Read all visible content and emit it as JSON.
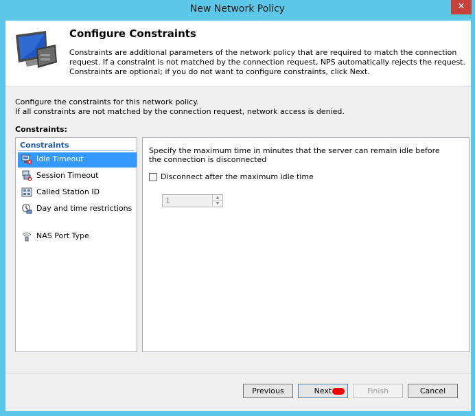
{
  "window": {
    "title": "New Network Policy",
    "close_symbol": "✕"
  },
  "header": {
    "title": "Configure Constraints",
    "description": "Constraints are additional parameters of the network policy that are required to match the connection request. If a constraint is not matched by the connection request, NPS automatically rejects the request. Constraints are optional; if you do not want to configure constraints, click Next."
  },
  "intro": {
    "line1": "Configure the constraints for this network policy.",
    "line2": "If all constraints are not matched by the connection request, network access is denied."
  },
  "constraints": {
    "label": "Constraints:",
    "list_header": "Constraints",
    "items": [
      {
        "label": "Idle Timeout",
        "icon": "idle-timeout-icon",
        "selected": true
      },
      {
        "label": "Session Timeout",
        "icon": "session-timeout-icon",
        "selected": false
      },
      {
        "label": "Called Station ID",
        "icon": "called-station-icon",
        "selected": false
      },
      {
        "label": "Day and time restrictions",
        "icon": "clock-icon",
        "selected": false
      },
      {
        "label": "NAS Port Type",
        "icon": "nas-port-icon",
        "selected": false
      }
    ]
  },
  "panel": {
    "description": "Specify the maximum time in minutes that the server can remain idle before the connection is disconnected",
    "checkbox_label": "Disconnect after the maximum idle time",
    "checkbox_checked": false,
    "spinner_value": "1"
  },
  "buttons": {
    "previous": "Previous",
    "next": "Next",
    "finish": "Finish",
    "cancel": "Cancel"
  },
  "colors": {
    "title_bar": "#5cc7e8",
    "selection": "#3399ff",
    "close_button": "#c7423a"
  }
}
